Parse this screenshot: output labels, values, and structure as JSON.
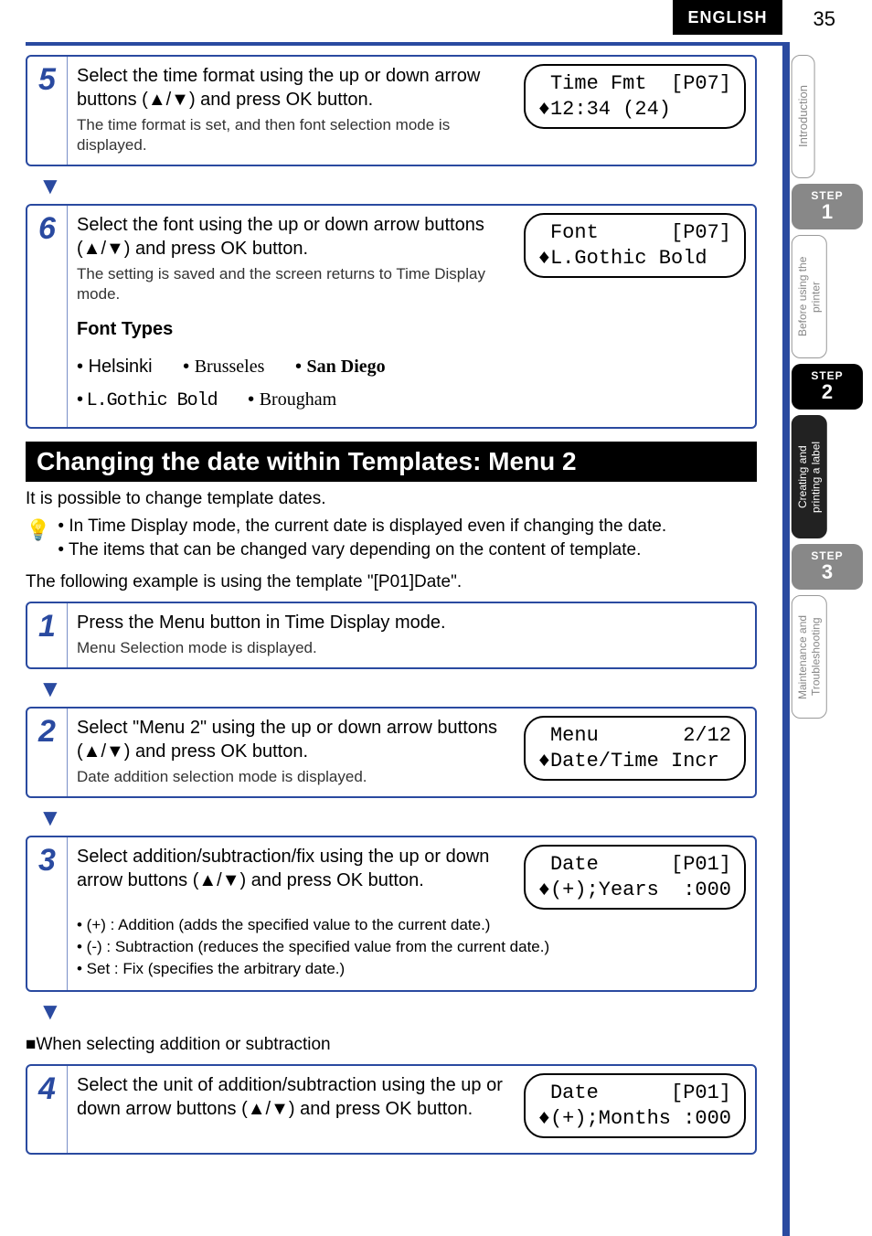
{
  "header": {
    "language": "ENGLISH",
    "page": "35"
  },
  "step5": {
    "num": "5",
    "title": "Select the time format using the up or down arrow buttons (▲/▼) and press OK button.",
    "sub": "The time format is set, and then font selection mode is displayed.",
    "lcd": " Time Fmt  [P07]\n♦12:34 (24)"
  },
  "step6": {
    "num": "6",
    "title": "Select the font using the up or down arrow buttons (▲/▼) and press OK button.",
    "sub": "The setting is saved and the screen returns to Time Display mode.",
    "lcd": " Font      [P07]\n♦L.Gothic Bold",
    "fonttypes_label": "Font Types",
    "fonts": {
      "helsinki": "Helsinki",
      "brusseles": "Brusseles",
      "sandiego": "San Diego",
      "lgothic": "L.Gothic Bold",
      "brougham": "Brougham"
    }
  },
  "section2": {
    "title": "Changing the date within Templates: Menu 2",
    "intro": "It is possible to change template dates.",
    "tip1": "• In Time Display mode, the current date is displayed even if changing the date.",
    "tip2": "• The items that can be changed vary depending on the content of template.",
    "example": "The following example is using the template \"[P01]Date\"."
  },
  "m2step1": {
    "num": "1",
    "title": "Press the Menu button in Time Display mode.",
    "sub": "Menu Selection mode is displayed."
  },
  "m2step2": {
    "num": "2",
    "title": "Select \"Menu 2\" using the up or down arrow buttons (▲/▼) and press OK button.",
    "sub": "Date addition selection mode is displayed.",
    "lcd": " Menu       2/12\n♦Date/Time Incr"
  },
  "m2step3": {
    "num": "3",
    "title": "Select addition/subtraction/fix using the up or down arrow buttons (▲/▼) and press OK button.",
    "lcd": " Date      [P01]\n♦(+);Years  :000",
    "b1": "• (+)    : Addition (adds the specified value to the current date.)",
    "b2": "• (-)    : Subtraction (reduces the specified value from the current date.)",
    "b3": "• Set   : Fix (specifies the arbitrary date.)"
  },
  "subselect": "■When selecting addition or subtraction",
  "m2step4": {
    "num": "4",
    "title": "Select the unit of addition/subtraction using the up or down arrow buttons (▲/▼) and press OK button.",
    "lcd": " Date      [P01]\n♦(+);Months :000"
  },
  "sidetabs": {
    "introduction": "Introduction",
    "step1_lbl": "STEP",
    "step1_num": "1",
    "before": "Before using\nthe printer",
    "step2_lbl": "STEP",
    "step2_num": "2",
    "creating": "Creating and\nprinting a label",
    "step3_lbl": "STEP",
    "step3_num": "3",
    "maint": "Maintenance and\nTroubleshooting"
  }
}
